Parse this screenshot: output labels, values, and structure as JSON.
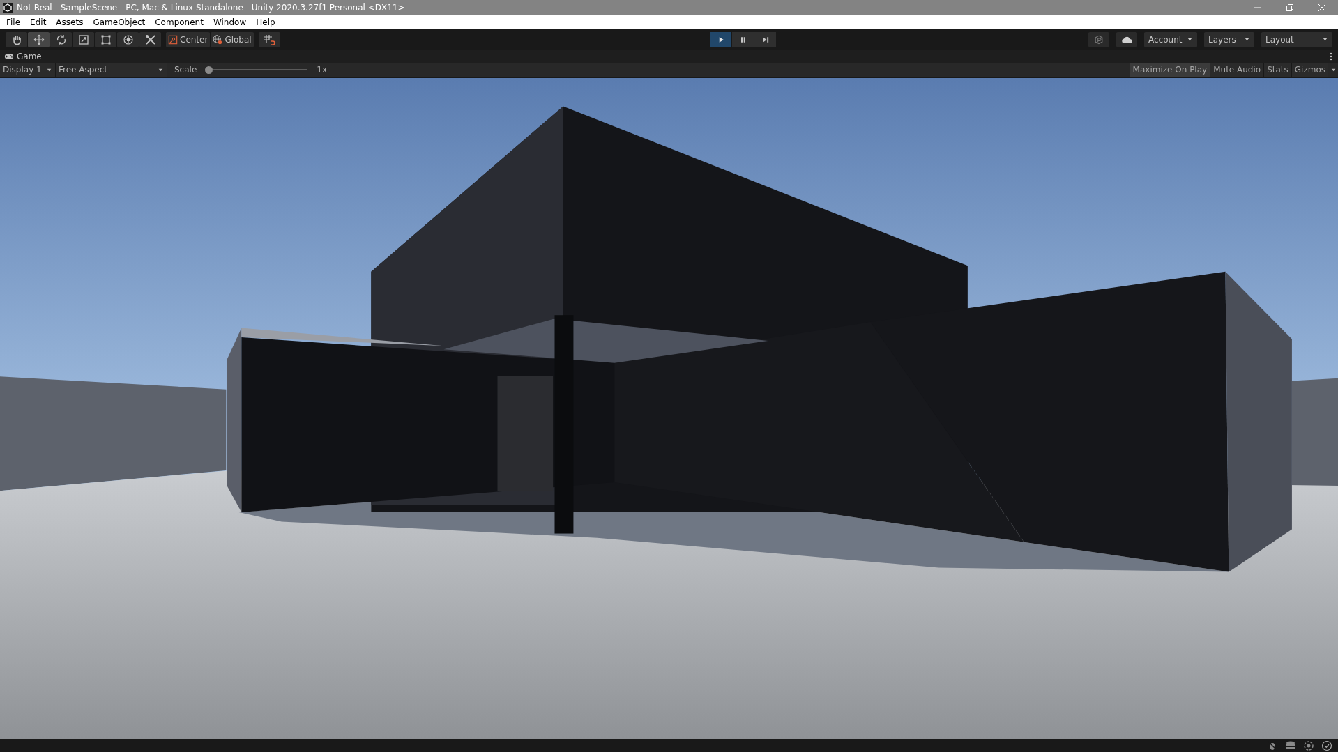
{
  "window": {
    "title": "Not Real - SampleScene - PC, Mac & Linux Standalone - Unity 2020.3.27f1 Personal <DX11>"
  },
  "menu": [
    "File",
    "Edit",
    "Assets",
    "GameObject",
    "Component",
    "Window",
    "Help"
  ],
  "toolbar": {
    "tools": [
      {
        "kind": "hand",
        "selected": false
      },
      {
        "kind": "move",
        "selected": true
      },
      {
        "kind": "rotate",
        "selected": false
      },
      {
        "kind": "scale",
        "selected": false
      },
      {
        "kind": "rect",
        "selected": false
      },
      {
        "kind": "transform",
        "selected": false
      },
      {
        "kind": "custom",
        "selected": false
      }
    ],
    "pivot": [
      {
        "kind": "center",
        "label": "Center"
      },
      {
        "kind": "global",
        "label": "Global"
      }
    ],
    "play": [
      {
        "kind": "play",
        "selected": true
      },
      {
        "kind": "pause",
        "selected": false
      },
      {
        "kind": "step",
        "selected": false
      }
    ],
    "dropdowns": [
      "Account",
      "Layers",
      "Layout"
    ]
  },
  "game_tab": {
    "label": "Game"
  },
  "game_toolbar": {
    "display": "Display 1",
    "aspect": "Free Aspect",
    "scale_label": "Scale",
    "scale": {
      "level": 0
    },
    "scale_reading": "1x",
    "toggles": [
      {
        "label": "Maximize On Play",
        "selected": true
      },
      {
        "label": "Mute Audio",
        "selected": false
      },
      {
        "label": "Stats",
        "selected": false
      },
      {
        "label": "Gizmos",
        "selected": false
      }
    ]
  }
}
